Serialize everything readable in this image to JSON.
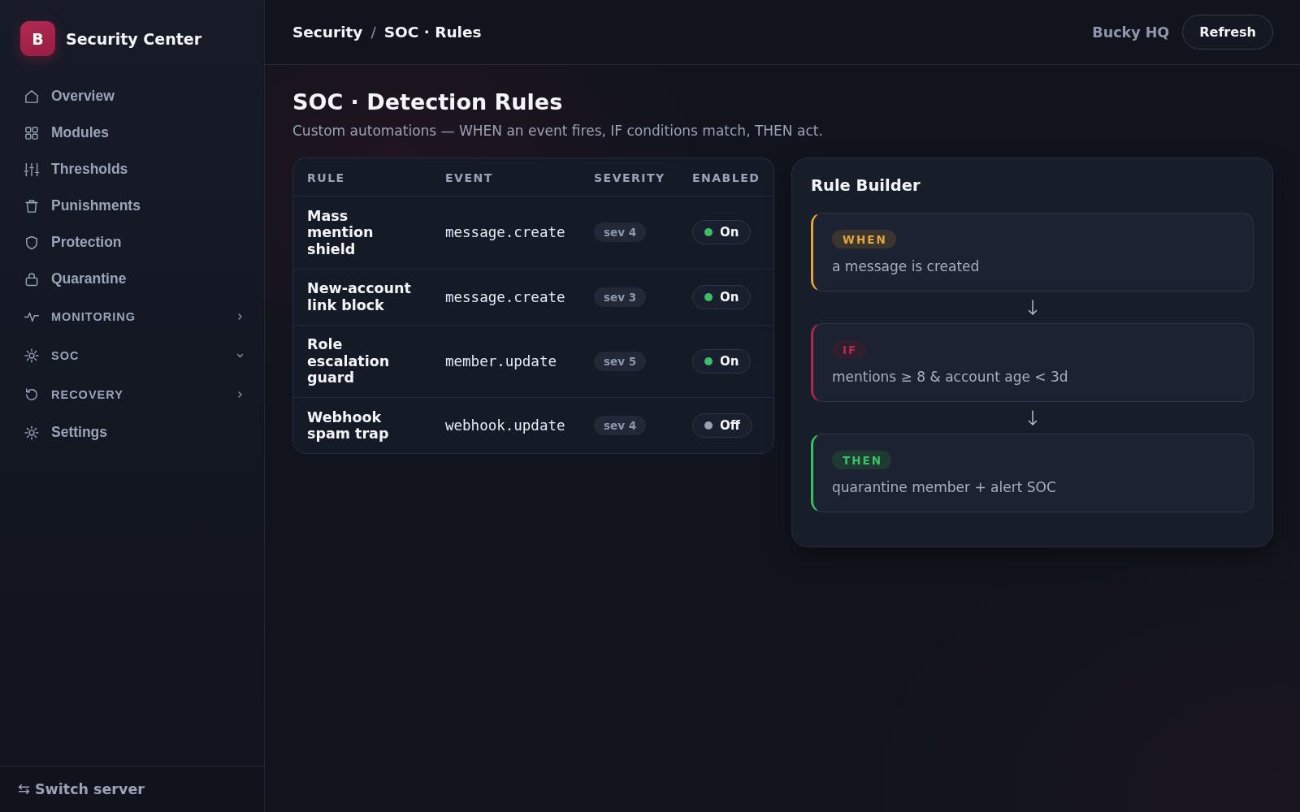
{
  "sidebar": {
    "brand": {
      "initial": "B",
      "title": "Security Center"
    },
    "items": [
      {
        "kind": "link",
        "label": "Overview"
      },
      {
        "kind": "link",
        "label": "Modules"
      },
      {
        "kind": "link",
        "label": "Thresholds"
      },
      {
        "kind": "link",
        "label": "Punishments"
      },
      {
        "kind": "link",
        "label": "Protection"
      },
      {
        "kind": "link",
        "label": "Quarantine"
      },
      {
        "kind": "section",
        "label": "MONITORING",
        "expanded": false
      },
      {
        "kind": "section",
        "label": "SOC",
        "expanded": true
      },
      {
        "kind": "section",
        "label": "RECOVERY",
        "expanded": false
      },
      {
        "kind": "link",
        "label": "Settings"
      }
    ],
    "footer_button": "Switch server"
  },
  "header": {
    "breadcrumb": [
      "Security",
      "SOC · Rules"
    ],
    "separator": "/",
    "server": "Bucky HQ",
    "refresh_button": "Refresh"
  },
  "page": {
    "title": "SOC · Detection Rules",
    "subtitle": "Custom automations — WHEN an event fires, IF conditions match, THEN act."
  },
  "rules_table": {
    "columns": [
      "RULE",
      "EVENT",
      "SEVERITY",
      "ENABLED"
    ],
    "rows": [
      {
        "rule": "Mass mention shield",
        "event": "message.create",
        "severity": "sev 4",
        "enabled": true,
        "status": "On"
      },
      {
        "rule": "New-account link block",
        "event": "message.create",
        "severity": "sev 3",
        "enabled": true,
        "status": "On"
      },
      {
        "rule": "Role escalation guard",
        "event": "member.update",
        "severity": "sev 5",
        "enabled": true,
        "status": "On"
      },
      {
        "rule": "Webhook spam trap",
        "event": "webhook.update",
        "severity": "sev 4",
        "enabled": false,
        "status": "Off"
      }
    ]
  },
  "rule_builder": {
    "title": "Rule Builder",
    "steps": [
      {
        "kind": "when",
        "tag": "WHEN",
        "text": "a message is created"
      },
      {
        "kind": "if",
        "tag": "IF",
        "text": "mentions ≥ 8 & account age < 3d"
      },
      {
        "kind": "then",
        "tag": "THEN",
        "text": "quarantine member + alert SOC"
      }
    ]
  }
}
